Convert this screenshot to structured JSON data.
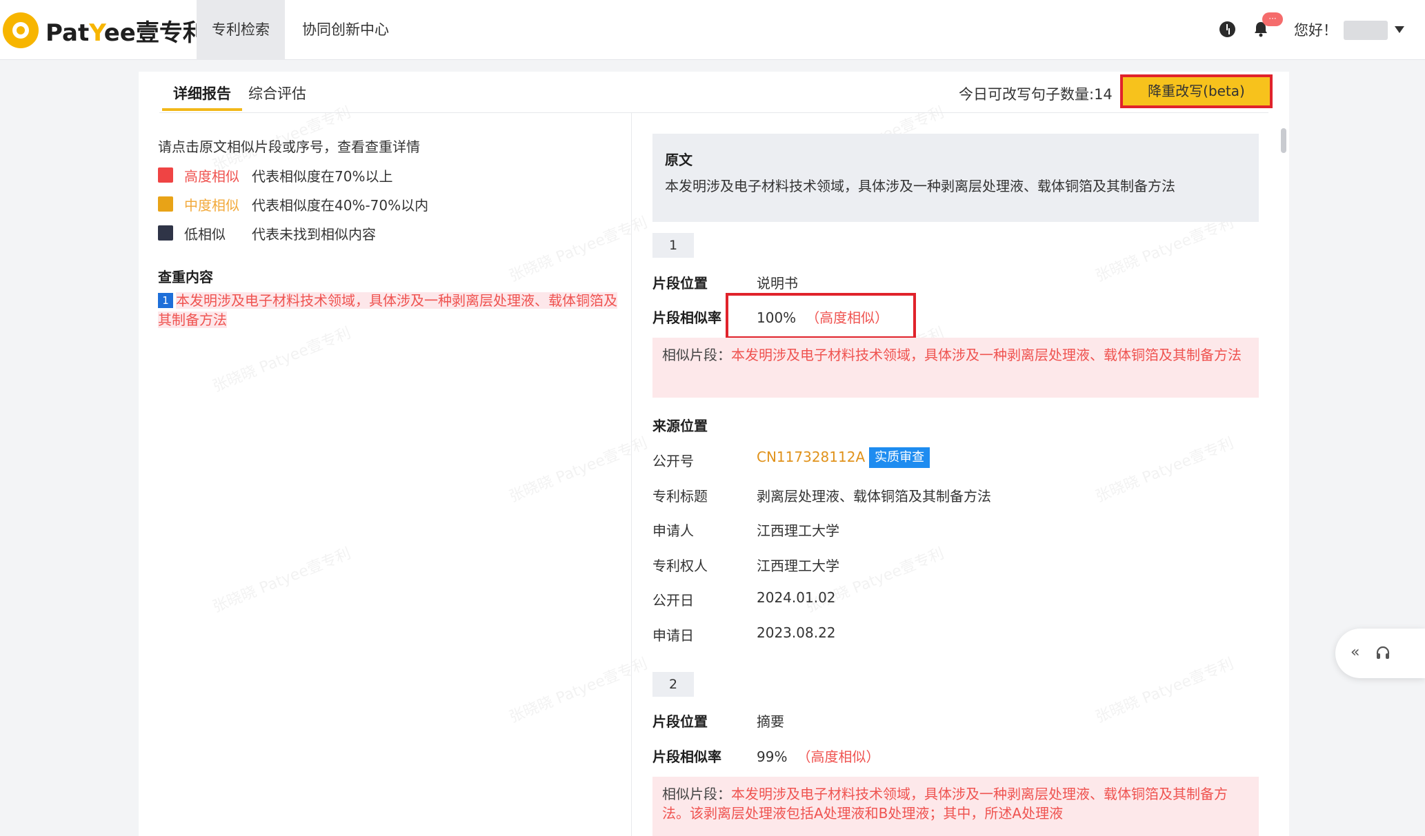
{
  "header": {
    "logo_text_a": "Pat",
    "logo_text_y": "Y",
    "logo_text_b": "ee壹专利",
    "nav": [
      "专利检索",
      "协同创新中心"
    ],
    "greeting": "您好！",
    "notification_badge": "···"
  },
  "tabs": [
    "详细报告",
    "综合评估"
  ],
  "quota_text": "今日可改写句子数量:14",
  "rewrite_button": "降重改写(beta)",
  "left": {
    "hint": "请点击原文相似片段或序号，查看查重详情",
    "legend": [
      {
        "term": "高度相似",
        "desc": "代表相似度在70%以上",
        "color": "#ef4444",
        "term_color": "#ef5350"
      },
      {
        "term": "中度相似",
        "desc": "代表相似度在40%-70%以内",
        "color": "#e8a317",
        "term_color": "#f2a93b"
      },
      {
        "term": "低相似",
        "desc": "代表未找到相似内容",
        "color": "#2f3447",
        "term_color": "#333333"
      }
    ],
    "section_title": "查重内容",
    "content_no": "1",
    "content_text": "本发明涉及电子材料技术领域，具体涉及一种剥离层处理液、载体铜箔及其制备方法"
  },
  "right": {
    "orig_title": "原文",
    "orig_text": "本发明涉及电子材料技术领域，具体涉及一种剥离层处理液、载体铜箔及其制备方法",
    "results": [
      {
        "seq": "1",
        "pos_label": "片段位置",
        "pos_value": "说明书",
        "rate_label": "片段相似率",
        "rate_value": "100%",
        "rate_level": "（高度相似）",
        "seg_label": "相似片段：",
        "seg_text": "本发明涉及电子材料技术领域，具体涉及一种剥离层处理液、载体铜箔及其制备方法",
        "source_title": "来源位置",
        "fields": [
          {
            "label": "公开号",
            "value": "CN117328112A",
            "badge": "实质审查"
          },
          {
            "label": "专利标题",
            "value": "剥离层处理液、载体铜箔及其制备方法"
          },
          {
            "label": "申请人",
            "value": "江西理工大学"
          },
          {
            "label": "专利权人",
            "value": "江西理工大学"
          },
          {
            "label": "公开日",
            "value": "2024.01.02"
          },
          {
            "label": "申请日",
            "value": "2023.08.22"
          }
        ]
      },
      {
        "seq": "2",
        "pos_label": "片段位置",
        "pos_value": "摘要",
        "rate_label": "片段相似率",
        "rate_value": "99%",
        "rate_level": "（高度相似）",
        "seg_label": "相似片段：",
        "seg_text": "本发明涉及电子材料技术领域，具体涉及一种剥离层处理液、载体铜箔及其制备方法。该剥离层处理液包括A处理液和B处理液；其中，所述A处理液"
      }
    ]
  },
  "watermark": "张晓晓 Patyee壹专利",
  "colors": {
    "accent": "#f7c21c",
    "high": "#ef5350",
    "link": "#e0921b",
    "badge": "#1e8cf0"
  }
}
